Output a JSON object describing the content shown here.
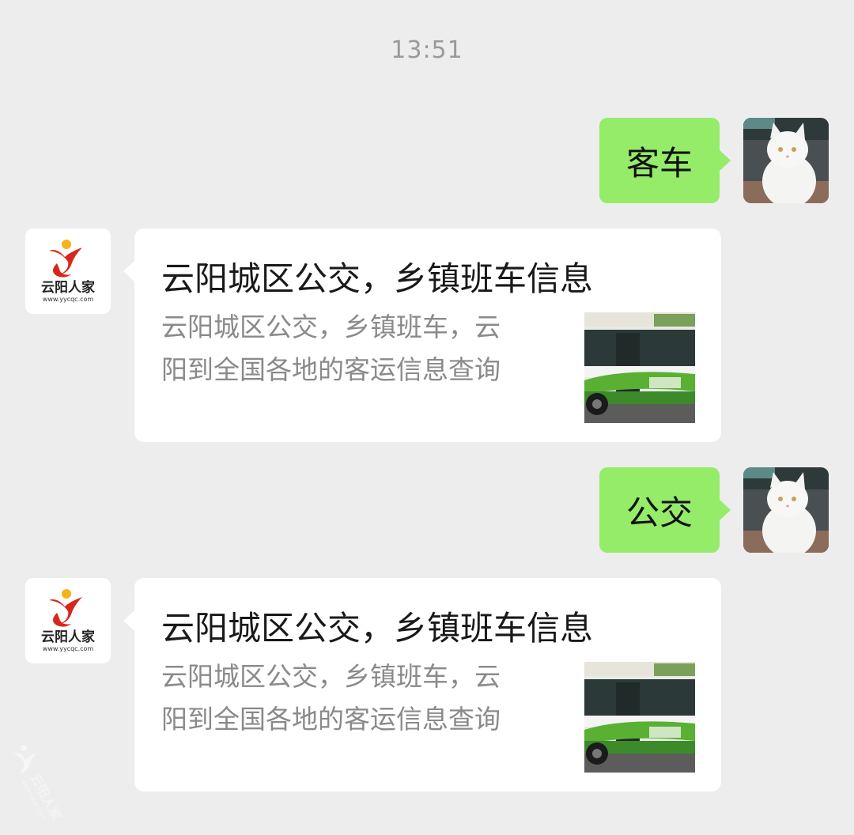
{
  "chat": {
    "timestamp": "13:51",
    "messages": [
      {
        "from": "user",
        "type": "text",
        "text": "客车"
      },
      {
        "from": "bot",
        "type": "link_card",
        "title": "云阳城区公交，乡镇班车信息",
        "description_line1": "云阳城区公交，乡镇班车，云",
        "description_line2": "阳到全国各地的客运信息查询"
      },
      {
        "from": "user",
        "type": "text",
        "text": "公交"
      },
      {
        "from": "bot",
        "type": "link_card",
        "title": "云阳城区公交，乡镇班车信息",
        "description_line1": "云阳城区公交，乡镇班车，云",
        "description_line2": "阳到全国各地的客运信息查询"
      }
    ]
  },
  "bot_avatar": {
    "brand_text": "云阳人家",
    "brand_url": "www.yycqc.com",
    "brand_color": "#d9261c"
  },
  "watermark": {
    "text": "云阳人家",
    "url": "www.yycqc.com"
  },
  "colors": {
    "background": "#ededed",
    "outgoing_bubble": "#95ec69",
    "incoming_card": "#ffffff",
    "timestamp": "#9a9a9a",
    "description": "#8a8a8a"
  },
  "icons": {
    "user_avatar": "white-cat-photo",
    "card_thumbnail": "green-bus-photo"
  }
}
